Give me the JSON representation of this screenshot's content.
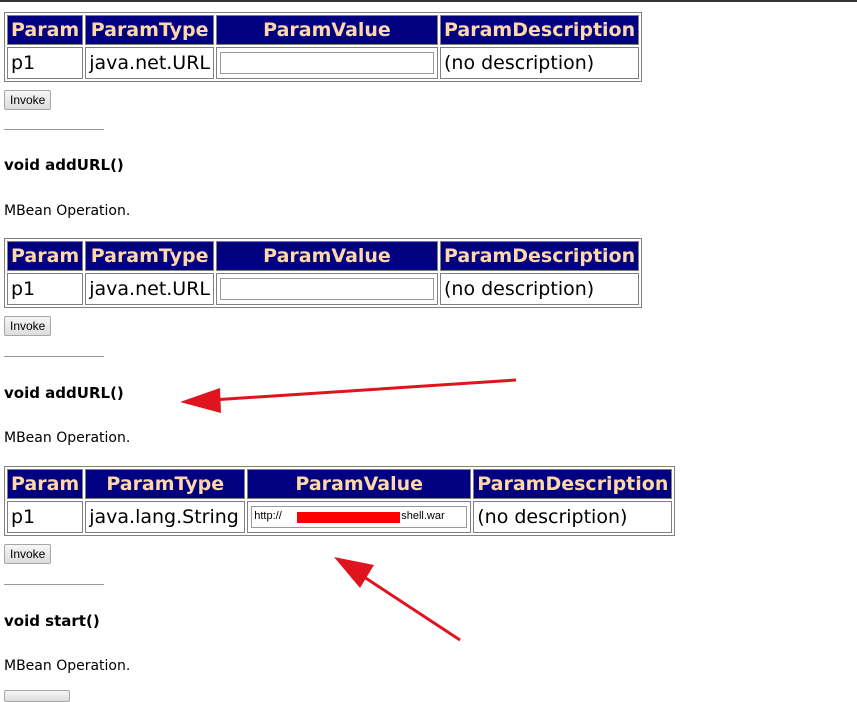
{
  "headers": {
    "param": "Param",
    "param_type": "ParamType",
    "param_value": "ParamValue",
    "param_description": "ParamDescription"
  },
  "op1": {
    "row": {
      "param": "p1",
      "type": "java.net.URL",
      "value": "",
      "description": "(no description)"
    },
    "invoke": "Invoke"
  },
  "op2": {
    "title": "void addURL()",
    "description": "MBean Operation.",
    "row": {
      "param": "p1",
      "type": "java.net.URL",
      "value": "",
      "description": "(no description)"
    },
    "invoke": "Invoke"
  },
  "op3": {
    "title": "void addURL()",
    "description": "MBean Operation.",
    "row": {
      "param": "p1",
      "type": "java.lang.String",
      "value_prefix": "http://",
      "value_suffix": "shell.war",
      "description": "(no description)"
    },
    "invoke": "Invoke"
  },
  "op4": {
    "title": "void start()",
    "description": "MBean Operation."
  },
  "colors": {
    "header_bg": "#000080",
    "header_text": "#ffd7a8",
    "annotation_arrow": "#e0141e",
    "redaction": "#ff0000"
  }
}
